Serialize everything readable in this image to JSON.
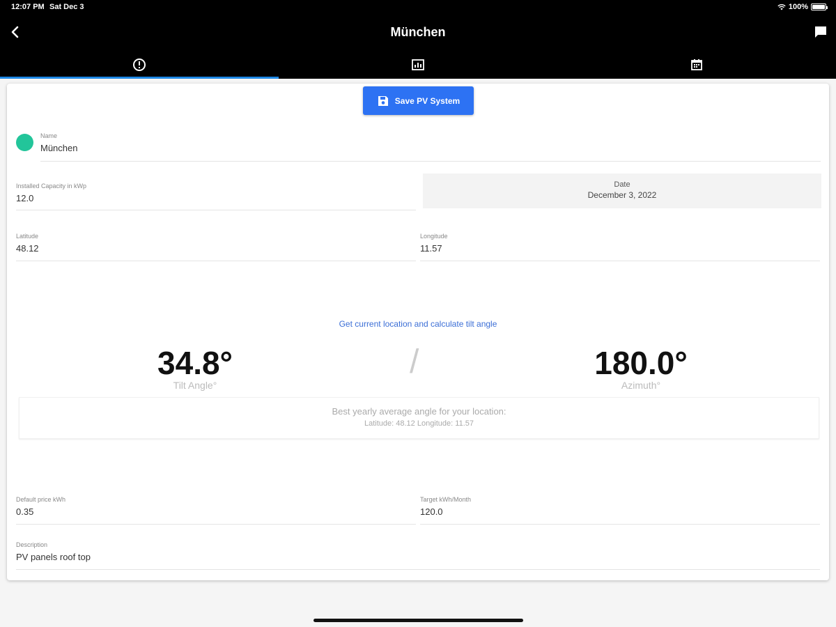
{
  "status_bar": {
    "time": "12:07 PM",
    "date": "Sat Dec 3",
    "battery": "100%"
  },
  "header": {
    "title": "München"
  },
  "tabs": [
    {
      "name": "info-icon",
      "active": true
    },
    {
      "name": "chart-icon",
      "active": false
    },
    {
      "name": "calendar-icon",
      "active": false
    }
  ],
  "form": {
    "save_label": "Save PV System",
    "name": {
      "label": "Name",
      "value": "München"
    },
    "capacity": {
      "label": "Installed Capacity in kWp",
      "value": "12.0"
    },
    "date": {
      "label": "Date",
      "value": "December 3, 2022"
    },
    "latitude": {
      "label": "Latitude",
      "value": "48.12"
    },
    "longitude": {
      "label": "Longitude",
      "value": "11.57"
    },
    "location_link": "Get current location and calculate tilt angle",
    "tilt": {
      "value": "34.8°",
      "label": "Tilt Angle°"
    },
    "separator": "/",
    "azimuth": {
      "value": "180.0°",
      "label": "Azimuth°"
    },
    "best_angle": {
      "title": "Best yearly average angle for your location:",
      "coords": "Latitude: 48.12 Longitude: 11.57"
    },
    "price": {
      "label": "Default price kWh",
      "value": "0.35"
    },
    "target": {
      "label": "Target kWh/Month",
      "value": "120.0"
    },
    "description": {
      "label": "Description",
      "value": "PV panels roof top"
    }
  },
  "colors": {
    "accent": "#2d72f3",
    "tab_indicator": "#1e88e5",
    "name_dot": "#22c59a",
    "link": "#3b6ed6"
  }
}
